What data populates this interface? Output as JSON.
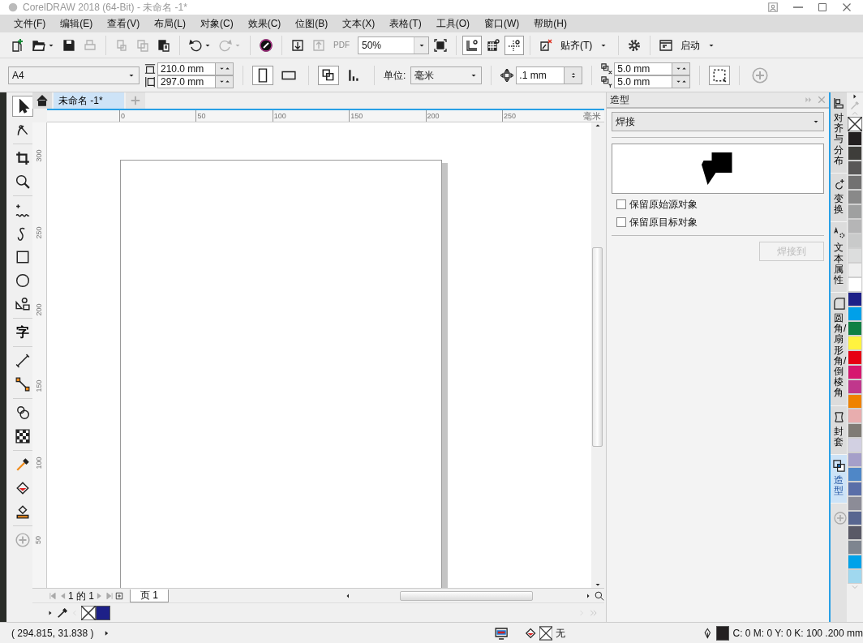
{
  "window": {
    "title": "CorelDRAW 2018 (64-Bit) - 未命名 -1*"
  },
  "menu": [
    "文件(F)",
    "编辑(E)",
    "查看(V)",
    "布局(L)",
    "对象(C)",
    "效果(C)",
    "位图(B)",
    "文本(X)",
    "表格(T)",
    "工具(O)",
    "窗口(W)",
    "帮助(H)"
  ],
  "toolbar": [
    {
      "kind": "new",
      "disabled": false,
      "selected": false
    },
    {
      "kind": "open",
      "disabled": false,
      "selected": false
    },
    {
      "kind": "save",
      "disabled": false,
      "selected": false
    },
    {
      "kind": "print",
      "disabled": true,
      "selected": false
    },
    {
      "kind": "sep"
    },
    {
      "kind": "cut",
      "disabled": true,
      "selected": false
    },
    {
      "kind": "copy",
      "disabled": true,
      "selected": false
    },
    {
      "kind": "paste",
      "disabled": false,
      "selected": false
    },
    {
      "kind": "sep"
    },
    {
      "kind": "undo",
      "disabled": false,
      "selected": false
    },
    {
      "kind": "redo",
      "disabled": true,
      "selected": false
    },
    {
      "kind": "sep"
    },
    {
      "kind": "connect",
      "disabled": false,
      "selected": false
    },
    {
      "kind": "sep"
    },
    {
      "kind": "import",
      "disabled": false,
      "selected": false
    },
    {
      "kind": "export",
      "disabled": true,
      "selected": false
    },
    {
      "kind": "label",
      "label": "PDF",
      "disabled": true
    },
    {
      "kind": "zoom",
      "value": "50%"
    },
    {
      "kind": "fullscreen",
      "disabled": false,
      "selected": false
    },
    {
      "kind": "sep"
    },
    {
      "kind": "rulers",
      "disabled": false,
      "selected": true
    },
    {
      "kind": "grid",
      "disabled": false,
      "selected": false
    },
    {
      "kind": "guides",
      "disabled": false,
      "selected": true
    },
    {
      "kind": "sep"
    },
    {
      "kind": "snapoff",
      "disabled": false,
      "selected": false
    },
    {
      "kind": "menu",
      "label": "贴齐(T)"
    },
    {
      "kind": "sep"
    },
    {
      "kind": "gear",
      "disabled": false,
      "selected": false
    },
    {
      "kind": "sep"
    },
    {
      "kind": "launch",
      "disabled": false,
      "selected": false
    },
    {
      "kind": "menu",
      "label": "启动"
    }
  ],
  "property_bar": {
    "paper": "A4",
    "width": "210.0 mm",
    "height": "297.0 mm",
    "orientations": [
      {
        "kind": "portrait",
        "selected": true
      },
      {
        "kind": "landscape",
        "selected": false
      }
    ],
    "page_modes": [
      {
        "kind": "allpages",
        "selected": true
      },
      {
        "kind": "current",
        "selected": false
      }
    ],
    "unit_label": "单位:",
    "unit": "毫米",
    "nudge": ".1 mm",
    "dup_x": "5.0 mm",
    "dup_y": "5.0 mm"
  },
  "toolbox": [
    {
      "kind": "pick",
      "selected": true
    },
    {
      "kind": "shape",
      "selected": false
    },
    {
      "kind": "sep"
    },
    {
      "kind": "crop",
      "selected": false
    },
    {
      "kind": "zoom",
      "selected": false
    },
    {
      "kind": "sep"
    },
    {
      "kind": "freehand",
      "selected": false
    },
    {
      "kind": "artistic",
      "selected": false
    },
    {
      "kind": "rect",
      "selected": false
    },
    {
      "kind": "ellipse",
      "selected": false
    },
    {
      "kind": "shapes",
      "selected": false
    },
    {
      "kind": "sep"
    },
    {
      "kind": "text",
      "label": "字",
      "selected": false
    },
    {
      "kind": "sep"
    },
    {
      "kind": "dimension",
      "selected": false
    },
    {
      "kind": "connector",
      "selected": false
    },
    {
      "kind": "sep"
    },
    {
      "kind": "blend",
      "selected": false
    },
    {
      "kind": "transparency",
      "selected": false
    },
    {
      "kind": "sep"
    },
    {
      "kind": "eyedropper",
      "selected": false
    },
    {
      "kind": "fill",
      "selected": false
    },
    {
      "kind": "smartfill",
      "selected": false
    },
    {
      "kind": "sep"
    },
    {
      "kind": "plus",
      "selected": false
    }
  ],
  "document_tabs": [
    {
      "title": "未命名 -1*",
      "selected": true
    }
  ],
  "ruler": {
    "horizontal": [
      "0",
      "50",
      "100",
      "150",
      "200",
      "250"
    ],
    "unit": "毫米",
    "vertical": [
      "300",
      "250",
      "200",
      "150",
      "100",
      "50"
    ]
  },
  "page_nav": {
    "pages": "1 的 1",
    "page_tab": "页 1"
  },
  "docker": {
    "title": "造型",
    "mode": "焊接",
    "options": [
      {
        "label": "保留原始源对象",
        "checked": false
      },
      {
        "label": "保留原目标对象",
        "checked": false
      }
    ],
    "apply_button": {
      "label": "焊接到",
      "disabled": true
    }
  },
  "docker_tabs": [
    {
      "kind": "align",
      "label": "对齐与分布",
      "selected": false
    },
    {
      "kind": "transform",
      "label": "变换",
      "selected": false
    },
    {
      "kind": "textprops",
      "label": "文本属性",
      "selected": false
    },
    {
      "kind": "fillet",
      "label": "圆角/扇形角/倒棱角",
      "selected": false
    },
    {
      "kind": "envelope",
      "label": "封套",
      "selected": false
    },
    {
      "kind": "shaping",
      "label": "造型",
      "selected": true
    }
  ],
  "palette": [
    {
      "kind": "none"
    },
    {
      "kind": "swatch",
      "color": "#231f20"
    },
    {
      "kind": "swatch",
      "color": "#3e3d3a"
    },
    {
      "kind": "swatch",
      "color": "#595757"
    },
    {
      "kind": "swatch",
      "color": "#727171"
    },
    {
      "kind": "swatch",
      "color": "#898989"
    },
    {
      "kind": "swatch",
      "color": "#9fa0a0"
    },
    {
      "kind": "swatch",
      "color": "#b5b5b6"
    },
    {
      "kind": "swatch",
      "color": "#c9caca"
    },
    {
      "kind": "swatch",
      "color": "#dcdddd"
    },
    {
      "kind": "swatch",
      "color": "#efefef"
    },
    {
      "kind": "swatch",
      "color": "#ffffff"
    },
    {
      "kind": "swatch",
      "color": "#1d2088"
    },
    {
      "kind": "swatch",
      "color": "#00a0e9"
    },
    {
      "kind": "swatch",
      "color": "#108043"
    },
    {
      "kind": "swatch",
      "color": "#fff33f"
    },
    {
      "kind": "swatch",
      "color": "#e60012"
    },
    {
      "kind": "swatch",
      "color": "#d6176f"
    },
    {
      "kind": "swatch",
      "color": "#c0378c"
    },
    {
      "kind": "swatch",
      "color": "#ef8200"
    },
    {
      "kind": "swatch",
      "color": "#e8adae"
    },
    {
      "kind": "swatch",
      "color": "#7f7b75"
    },
    {
      "kind": "swatch",
      "color": "#d2d0e2"
    },
    {
      "kind": "swatch",
      "color": "#a59fc9"
    },
    {
      "kind": "swatch",
      "color": "#4f87c7"
    },
    {
      "kind": "swatch",
      "color": "#5a6ea8"
    },
    {
      "kind": "swatch",
      "color": "#8c8c97"
    },
    {
      "kind": "swatch",
      "color": "#586690"
    },
    {
      "kind": "swatch",
      "color": "#595966"
    },
    {
      "kind": "swatch",
      "color": "#7e858f"
    },
    {
      "kind": "swatch",
      "color": "#00a2e9"
    },
    {
      "kind": "swatch",
      "color": "#a0d8ef"
    }
  ],
  "document_palette": [
    {
      "kind": "none"
    },
    {
      "kind": "swatch",
      "color": "#1d2088"
    }
  ],
  "status_bar": {
    "coordinates": "( 294.815, 31.838 )",
    "fill": "无",
    "outline": "C: 0 M: 0 Y: 0 K: 100  .200 mm"
  }
}
